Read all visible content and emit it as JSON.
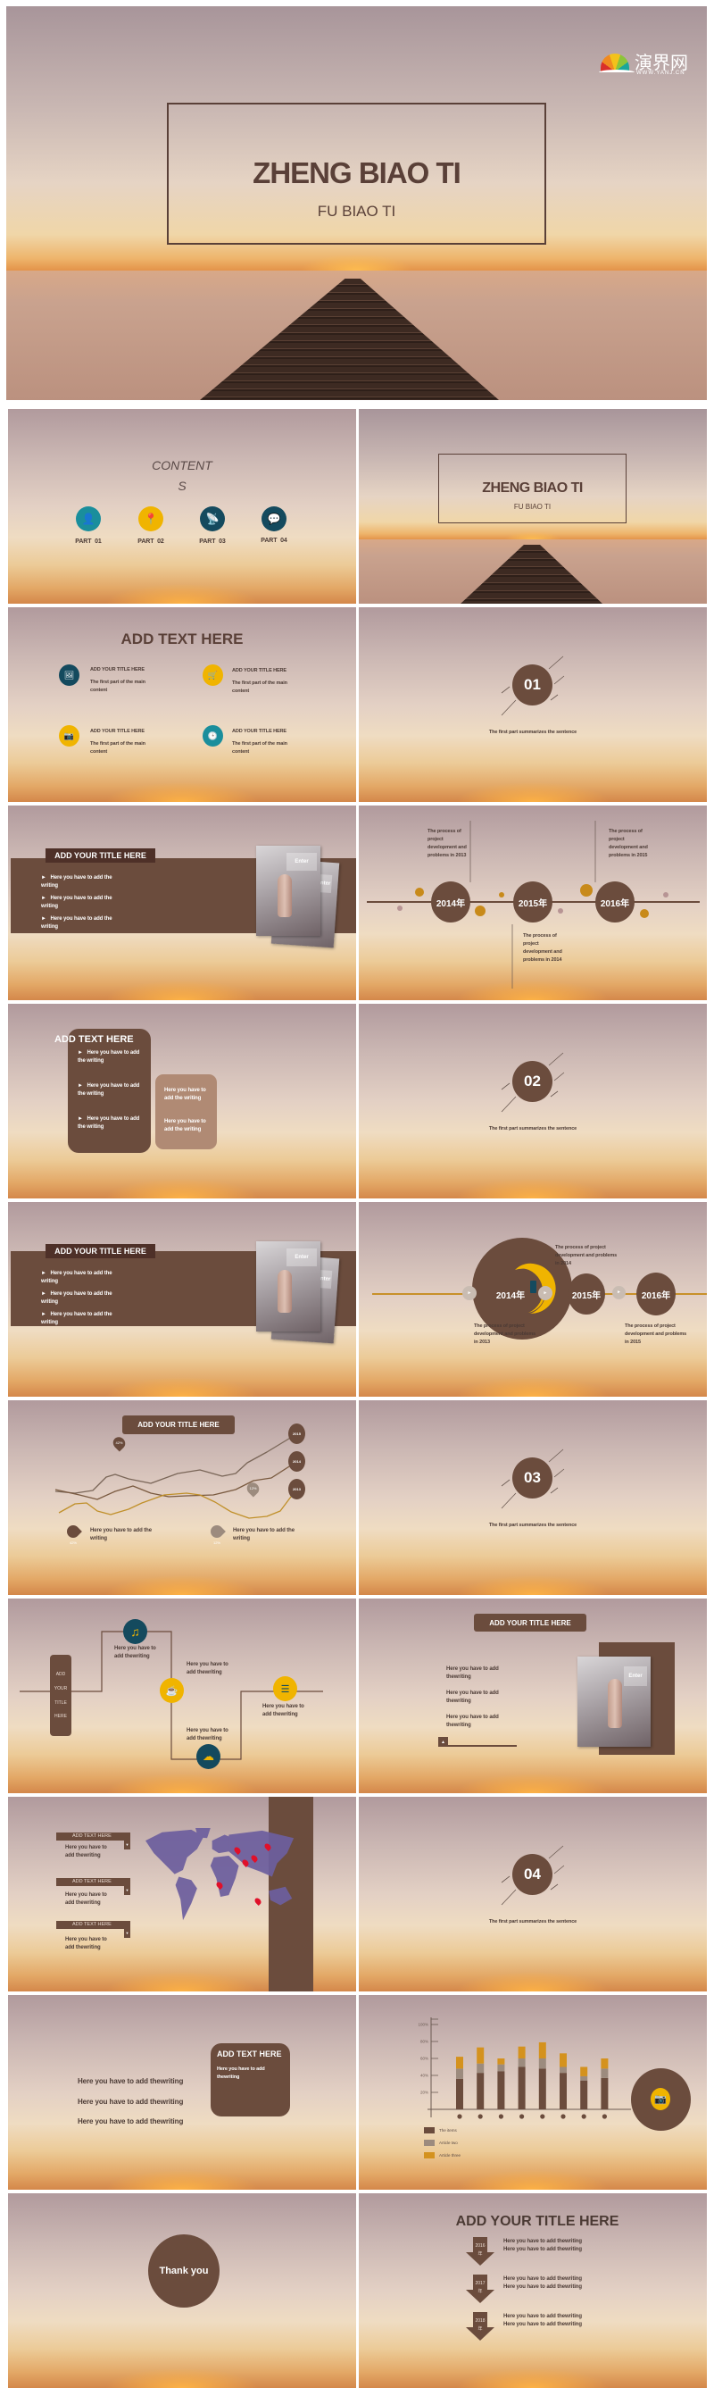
{
  "hero": {
    "title": "ZHENG BIAO TI",
    "subtitle": "FU BIAO TI",
    "logo": {
      "name": "演界网",
      "url": "WWW.YANJ.CN"
    }
  },
  "contents": {
    "title": "CONTENT",
    "title_wrap": "S",
    "parts": [
      {
        "label": "PART  01",
        "icon": "user-icon"
      },
      {
        "label": "PART  02",
        "icon": "map-pin-icon"
      },
      {
        "label": "PART  03",
        "icon": "satellite-dish-icon"
      },
      {
        "label": "PART  04",
        "icon": "chat-bubble-icon"
      }
    ]
  },
  "cover2": {
    "title": "ZHENG BIAO TI",
    "subtitle": "FU BIAO TI"
  },
  "overview": {
    "title": "ADD TEXT HERE",
    "items": [
      {
        "title": "ADD YOUR TITLE HERE",
        "desc": "The first part of the main content",
        "icon": "picture-icon"
      },
      {
        "title": "ADD YOUR TITLE HERE",
        "desc": "The first part of the main content",
        "icon": "cart-icon"
      },
      {
        "title": "ADD YOUR TITLE HERE",
        "desc": "The first part of the main content",
        "icon": "camera-icon"
      },
      {
        "title": "ADD YOUR TITLE HERE",
        "desc": "The first part of the main content",
        "icon": "clock-icon"
      }
    ]
  },
  "sections": [
    {
      "number": "01",
      "caption": "The first part summarizes the sentence"
    },
    {
      "number": "02",
      "caption": "The first part summarizes the sentence"
    },
    {
      "number": "03",
      "caption": "The first part summarizes the sentence"
    },
    {
      "number": "04",
      "caption": "The first part summarizes the sentence"
    }
  ],
  "band_slides": [
    {
      "title": "ADD YOUR TITLE HERE",
      "bullets": [
        "►   Here you have to add the writing",
        "►   Here you have to add the writing",
        "►   Here you have to add the writing"
      ],
      "photo_label": "Enter"
    },
    {
      "title": "ADD YOUR TITLE HERE",
      "bullets": [
        "►   Here you have to add the writing",
        "►   Here you have to add the writing",
        "►   Here you have to add the writing"
      ],
      "photo_label": "Enter"
    }
  ],
  "timeline1": {
    "years": [
      "2014年",
      "2015年",
      "2016年"
    ],
    "notes": [
      "The process of project development and problems in 2013",
      "The process of project development and problems in 2015",
      "The process of project development and problems in 2014"
    ]
  },
  "textboxes": {
    "title": "ADD TEXT HERE",
    "bullets": [
      "►   Here you have to add the writing",
      "►   Here you have to add the writing",
      "►   Here you have to add the writing"
    ],
    "side": [
      "Here you have to add the writing",
      "Here you have to add the writing"
    ]
  },
  "timeline2": {
    "years": [
      "2014年",
      "2015年",
      "2016年"
    ],
    "notes": [
      "The process of project development and problems in 2014",
      "The process of project development and problems in 2013",
      "The process of project development and problems in 2015"
    ]
  },
  "lines_slide": {
    "title": "ADD YOUR TITLE HERE",
    "end_labels": [
      "2015",
      "2014",
      "2013"
    ],
    "pins": [
      "42%",
      "12%"
    ],
    "legend": [
      {
        "pin": "42%",
        "text": "Here you have to add the writing"
      },
      {
        "pin": "12%",
        "text": "Here you have to add the writing"
      }
    ]
  },
  "flow": {
    "vertical_title": [
      "ADD",
      "YOUR",
      "TITLE",
      "HERE"
    ],
    "steps": [
      "Here you have to add thewriting",
      "Here you have to add thewriting",
      "Here you have to add thewriting",
      "Here you have to add thewriting"
    ]
  },
  "photo_slide": {
    "title": "ADD YOUR TITLE HERE",
    "items": [
      "Here you have to add thewriting",
      "Here you have to add thewriting",
      "Here you have to add thewriting"
    ],
    "photo_label": "Enter"
  },
  "map_slide": {
    "tags": [
      {
        "label": "ADD TEXT HERE",
        "text": "Here you have to add thewriting"
      },
      {
        "label": "ADD TEXT HERE",
        "text": "Here you have to add thewriting"
      },
      {
        "label": "ADD TEXT HERE",
        "text": "Here you have to add thewriting"
      }
    ]
  },
  "text_box_slide": {
    "lines": [
      "Here you have to add thewriting",
      "Here you have to add thewriting",
      "Here you have to add thewriting"
    ],
    "box_title": "ADD TEXT HERE",
    "box_text": "Here you have to add thewriting"
  },
  "chart_data": {
    "type": "bar",
    "stacked": true,
    "ylim": [
      0,
      100
    ],
    "yticks": [
      "20%",
      "40%",
      "60%",
      "80%",
      "100%"
    ],
    "grid": false,
    "legend_position": "bottom-left",
    "series": [
      {
        "name": "The items",
        "color": "#6b4c3d",
        "values": [
          36,
          43,
          45,
          50,
          48,
          43,
          34,
          37
        ]
      },
      {
        "name": "Article two",
        "color": "#9c8b7e",
        "values": [
          12,
          11,
          8,
          10,
          12,
          7,
          5,
          11
        ]
      },
      {
        "name": "Article three",
        "color": "#d4921e",
        "values": [
          14,
          19,
          7,
          14,
          19,
          16,
          11,
          12
        ]
      }
    ]
  },
  "thanks": {
    "text": "Thank you"
  },
  "final": {
    "title": "ADD YOUR TITLE HERE",
    "rows": [
      {
        "year": "2016",
        "unit": "年",
        "lines": [
          "Here you have to add thewriting",
          "Here you have to add thewriting"
        ]
      },
      {
        "year": "2017",
        "unit": "年",
        "lines": [
          "Here you have to add thewriting",
          "Here you have to add thewriting"
        ]
      },
      {
        "year": "2018",
        "unit": "年",
        "lines": [
          "Here you have to add thewriting",
          "Here you have to add thewriting"
        ]
      }
    ]
  },
  "colors": {
    "brown": "#6b4c3d",
    "dark_brown": "#4e3028",
    "gold": "#d4921e",
    "teal": "#1a8e9c",
    "navy": "#144a5e",
    "yellow": "#f0b400",
    "map": "#6d5f9e",
    "pin": "#e0102a"
  }
}
